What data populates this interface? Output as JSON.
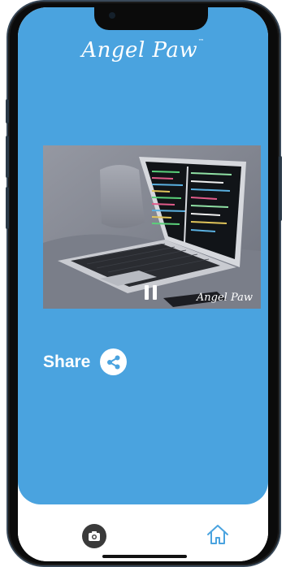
{
  "app": {
    "logo_text": "Angel Paw",
    "logo_tm": "™"
  },
  "video": {
    "watermark": "Angel Paw",
    "state": "playing",
    "icon": "pause-icon"
  },
  "share": {
    "label": "Share",
    "icon": "share-icon"
  },
  "tabbar": {
    "items": [
      {
        "name": "camera",
        "icon": "camera-icon"
      },
      {
        "name": "home",
        "icon": "home-icon"
      }
    ]
  },
  "colors": {
    "primary": "#4aa3df",
    "frame": "#0b0b0b",
    "tabbar": "#ffffff"
  }
}
